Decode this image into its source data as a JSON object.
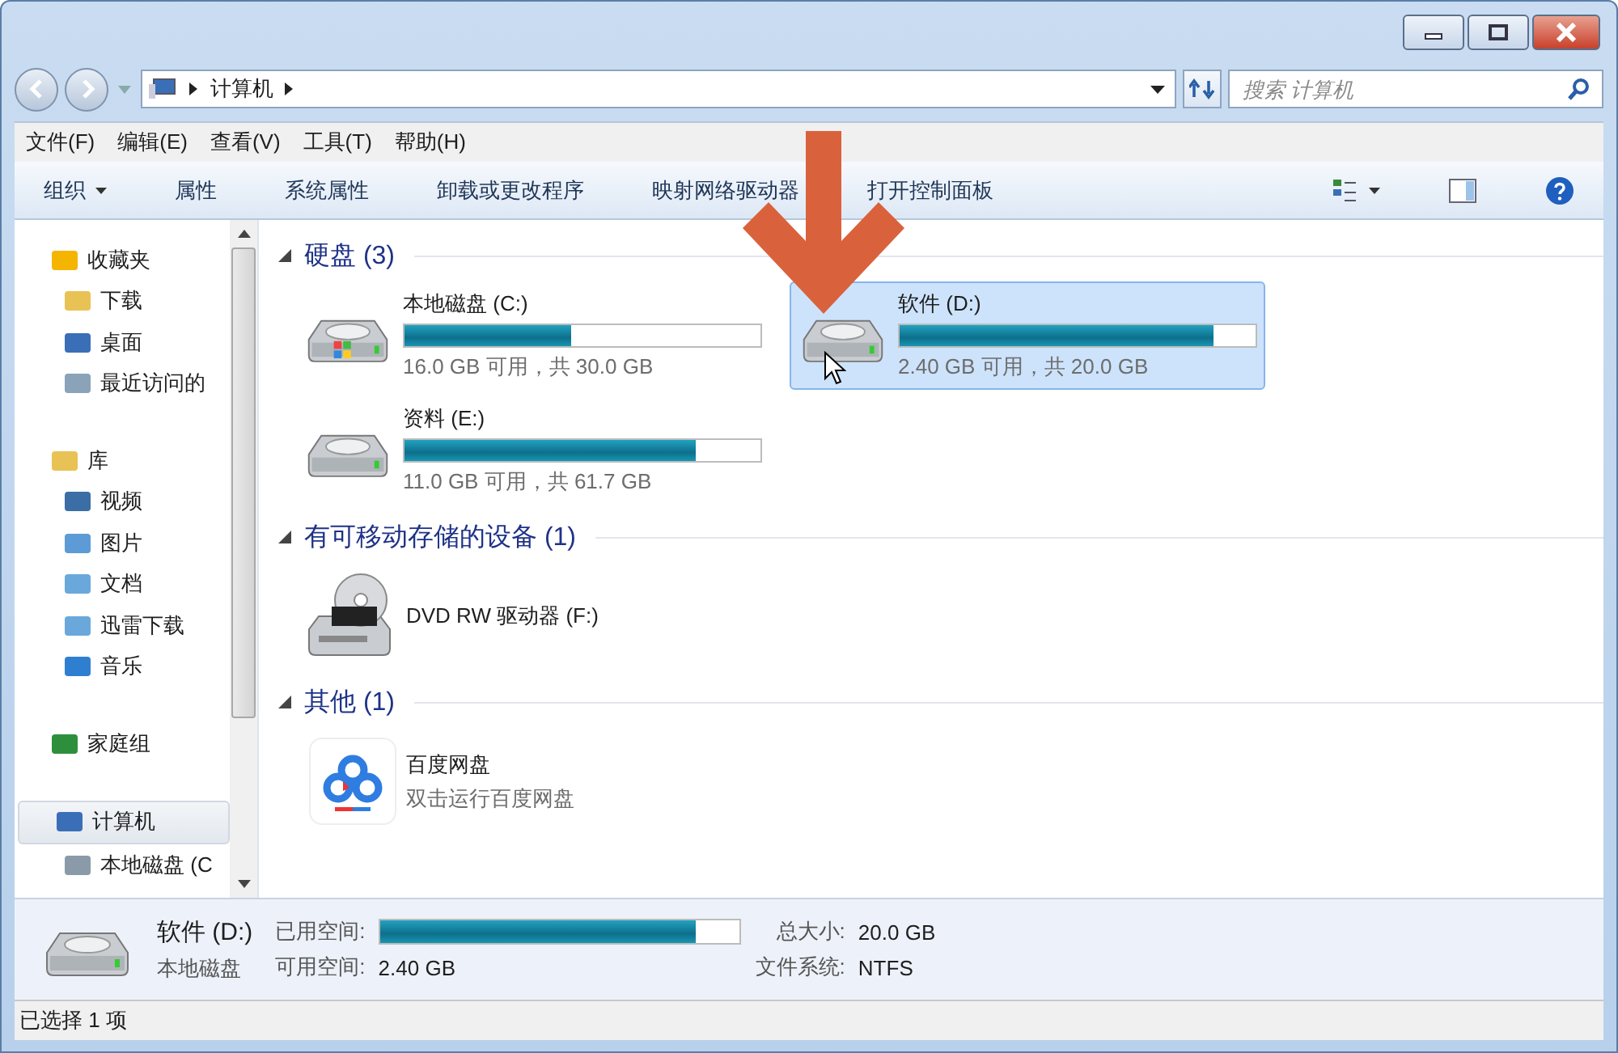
{
  "address": {
    "path": [
      "计算机"
    ],
    "search_placeholder": "搜索 计算机"
  },
  "menu": [
    "文件(F)",
    "编辑(E)",
    "查看(V)",
    "工具(T)",
    "帮助(H)"
  ],
  "toolbar": [
    {
      "label": "组织",
      "kind": "menu"
    },
    {
      "label": "属性",
      "kind": "button"
    },
    {
      "label": "系统属性",
      "kind": "button"
    },
    {
      "label": "卸载或更改程序",
      "kind": "button"
    },
    {
      "label": "映射网络驱动器",
      "kind": "button"
    },
    {
      "label": "打开控制面板",
      "kind": "button"
    }
  ],
  "sidebar": [
    {
      "label": "收藏夹",
      "selected": false,
      "children": [
        {
          "label": "下载",
          "selected": false
        },
        {
          "label": "桌面",
          "selected": false
        },
        {
          "label": "最近访问的",
          "selected": false
        }
      ]
    },
    {
      "label": "库",
      "selected": false,
      "children": [
        {
          "label": "视频",
          "selected": false
        },
        {
          "label": "图片",
          "selected": false
        },
        {
          "label": "文档",
          "selected": false
        },
        {
          "label": "迅雷下载",
          "selected": false
        },
        {
          "label": "音乐",
          "selected": false
        }
      ]
    },
    {
      "label": "家庭组",
      "selected": false
    },
    {
      "label": "计算机",
      "selected": true,
      "children": [
        {
          "label": "本地磁盘 (C",
          "selected": false
        }
      ]
    }
  ],
  "sections": [
    {
      "title": "硬盘 (3)",
      "expanded": true,
      "items": [
        {
          "kind": "system-drive",
          "name": "本地磁盘 (C:)",
          "level": 0.467,
          "reading": "16.0 GB 可用，共 30.0 GB",
          "selected": false
        },
        {
          "kind": "drive",
          "name": "软件 (D:)",
          "level": 0.88,
          "reading": "2.40 GB 可用，共 20.0 GB",
          "selected": true
        },
        {
          "kind": "drive",
          "name": "资料 (E:)",
          "level": 0.82,
          "reading": "11.0 GB 可用，共 61.7 GB",
          "selected": false
        }
      ]
    },
    {
      "title": "有可移动存储的设备 (1)",
      "expanded": true,
      "items": [
        {
          "kind": "dvd",
          "name": "DVD RW 驱动器 (F:)",
          "selected": false
        }
      ]
    },
    {
      "title": "其他 (1)",
      "expanded": true,
      "items": [
        {
          "kind": "app",
          "name": "百度网盘",
          "reading": "双击运行百度网盘",
          "selected": false
        }
      ]
    }
  ],
  "details": {
    "name": "软件 (D:)",
    "type": "本地磁盘",
    "used_label": "已用空间:",
    "level": 0.88,
    "free_label": "可用空间:",
    "free": "2.40 GB",
    "total_label": "总大小:",
    "total": "20.0 GB",
    "fs_label": "文件系统:",
    "fs": "NTFS"
  },
  "status_bar": "已选择 1 项"
}
